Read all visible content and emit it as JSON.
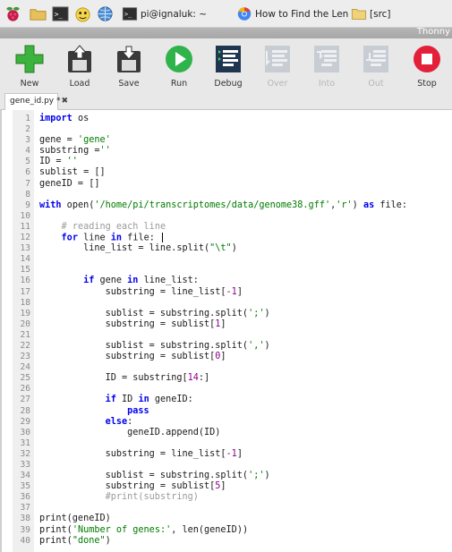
{
  "taskbar": {
    "icons": [
      "raspberry-menu-icon",
      "file-manager-icon",
      "terminal-icon",
      "thonny-icon",
      "web-browser-icon"
    ],
    "tasks": [
      {
        "label": "pi@ignaluk: ~",
        "icon": "terminal-icon"
      },
      {
        "label": "How to Find the Leng...",
        "icon": "chromium-icon"
      },
      {
        "label": "[src]",
        "icon": "folder-icon"
      }
    ]
  },
  "window": {
    "title": "Thonny"
  },
  "toolbar": {
    "buttons": [
      {
        "label": "New",
        "icon": "new-file-icon",
        "enabled": true
      },
      {
        "label": "Load",
        "icon": "load-icon",
        "enabled": true
      },
      {
        "label": "Save",
        "icon": "save-icon",
        "enabled": true
      },
      {
        "label": "Run",
        "icon": "run-icon",
        "enabled": true
      },
      {
        "label": "Debug",
        "icon": "debug-icon",
        "enabled": true
      },
      {
        "label": "Over",
        "icon": "step-over-icon",
        "enabled": false
      },
      {
        "label": "Into",
        "icon": "step-into-icon",
        "enabled": false
      },
      {
        "label": "Out",
        "icon": "step-out-icon",
        "enabled": false
      },
      {
        "label": "Stop",
        "icon": "stop-icon",
        "enabled": true
      }
    ]
  },
  "editor": {
    "tab": {
      "label": "gene_id.py *",
      "close": "✖"
    },
    "lines": [
      [
        {
          "t": "import",
          "c": "kw"
        },
        {
          "t": " os"
        }
      ],
      [],
      [
        {
          "t": "gene = "
        },
        {
          "t": "'gene'",
          "c": "str"
        }
      ],
      [
        {
          "t": "substring ="
        },
        {
          "t": "''",
          "c": "str"
        }
      ],
      [
        {
          "t": "ID = "
        },
        {
          "t": "''",
          "c": "str"
        }
      ],
      [
        {
          "t": "sublist = []"
        }
      ],
      [
        {
          "t": "geneID = []"
        }
      ],
      [],
      [
        {
          "t": "with",
          "c": "kw"
        },
        {
          "t": " open("
        },
        {
          "t": "'/home/pi/transcriptomes/data/genome38.gff'",
          "c": "str"
        },
        {
          "t": ","
        },
        {
          "t": "'r'",
          "c": "str"
        },
        {
          "t": ") "
        },
        {
          "t": "as",
          "c": "kw"
        },
        {
          "t": " file:"
        }
      ],
      [],
      [
        {
          "t": "    "
        },
        {
          "t": "# reading each line",
          "c": "cm"
        }
      ],
      [
        {
          "t": "    "
        },
        {
          "t": "for",
          "c": "kw"
        },
        {
          "t": " line "
        },
        {
          "t": "in",
          "c": "kw"
        },
        {
          "t": " file: "
        },
        {
          "t": "",
          "c": "cursor"
        }
      ],
      [
        {
          "t": "        line_list = line.split("
        },
        {
          "t": "\"\\t\"",
          "c": "str"
        },
        {
          "t": ")"
        }
      ],
      [],
      [],
      [
        {
          "t": "        "
        },
        {
          "t": "if",
          "c": "kw"
        },
        {
          "t": " gene "
        },
        {
          "t": "in",
          "c": "kw"
        },
        {
          "t": " line_list:"
        }
      ],
      [
        {
          "t": "            substring = line_list["
        },
        {
          "t": "-1",
          "c": "num-lit"
        },
        {
          "t": "]"
        }
      ],
      [],
      [
        {
          "t": "            sublist = substring.split("
        },
        {
          "t": "';'",
          "c": "str"
        },
        {
          "t": ")"
        }
      ],
      [
        {
          "t": "            substring = sublist["
        },
        {
          "t": "1",
          "c": "num-lit"
        },
        {
          "t": "]"
        }
      ],
      [],
      [
        {
          "t": "            sublist = substring.split("
        },
        {
          "t": "','",
          "c": "str"
        },
        {
          "t": ")"
        }
      ],
      [
        {
          "t": "            substring = sublist["
        },
        {
          "t": "0",
          "c": "num-lit"
        },
        {
          "t": "]"
        }
      ],
      [],
      [
        {
          "t": "            ID = substring["
        },
        {
          "t": "14",
          "c": "num-lit"
        },
        {
          "t": ":]"
        }
      ],
      [],
      [
        {
          "t": "            "
        },
        {
          "t": "if",
          "c": "kw"
        },
        {
          "t": " ID "
        },
        {
          "t": "in",
          "c": "kw"
        },
        {
          "t": " geneID:"
        }
      ],
      [
        {
          "t": "                "
        },
        {
          "t": "pass",
          "c": "kw"
        }
      ],
      [
        {
          "t": "            "
        },
        {
          "t": "else",
          "c": "kw"
        },
        {
          "t": ":"
        }
      ],
      [
        {
          "t": "                geneID.append(ID)"
        }
      ],
      [],
      [
        {
          "t": "            substring = line_list["
        },
        {
          "t": "-1",
          "c": "num-lit"
        },
        {
          "t": "]"
        }
      ],
      [],
      [
        {
          "t": "            sublist = substring.split("
        },
        {
          "t": "';'",
          "c": "str"
        },
        {
          "t": ")"
        }
      ],
      [
        {
          "t": "            substring = sublist["
        },
        {
          "t": "5",
          "c": "num-lit"
        },
        {
          "t": "]"
        }
      ],
      [
        {
          "t": "            "
        },
        {
          "t": "#print(substring)",
          "c": "cm"
        }
      ],
      [],
      [
        {
          "t": "print(geneID)"
        }
      ],
      [
        {
          "t": "print("
        },
        {
          "t": "'Number of genes:'",
          "c": "str"
        },
        {
          "t": ", len(geneID))"
        }
      ],
      [
        {
          "t": "print("
        },
        {
          "t": "\"done\"",
          "c": "str"
        },
        {
          "t": ")"
        }
      ]
    ]
  }
}
